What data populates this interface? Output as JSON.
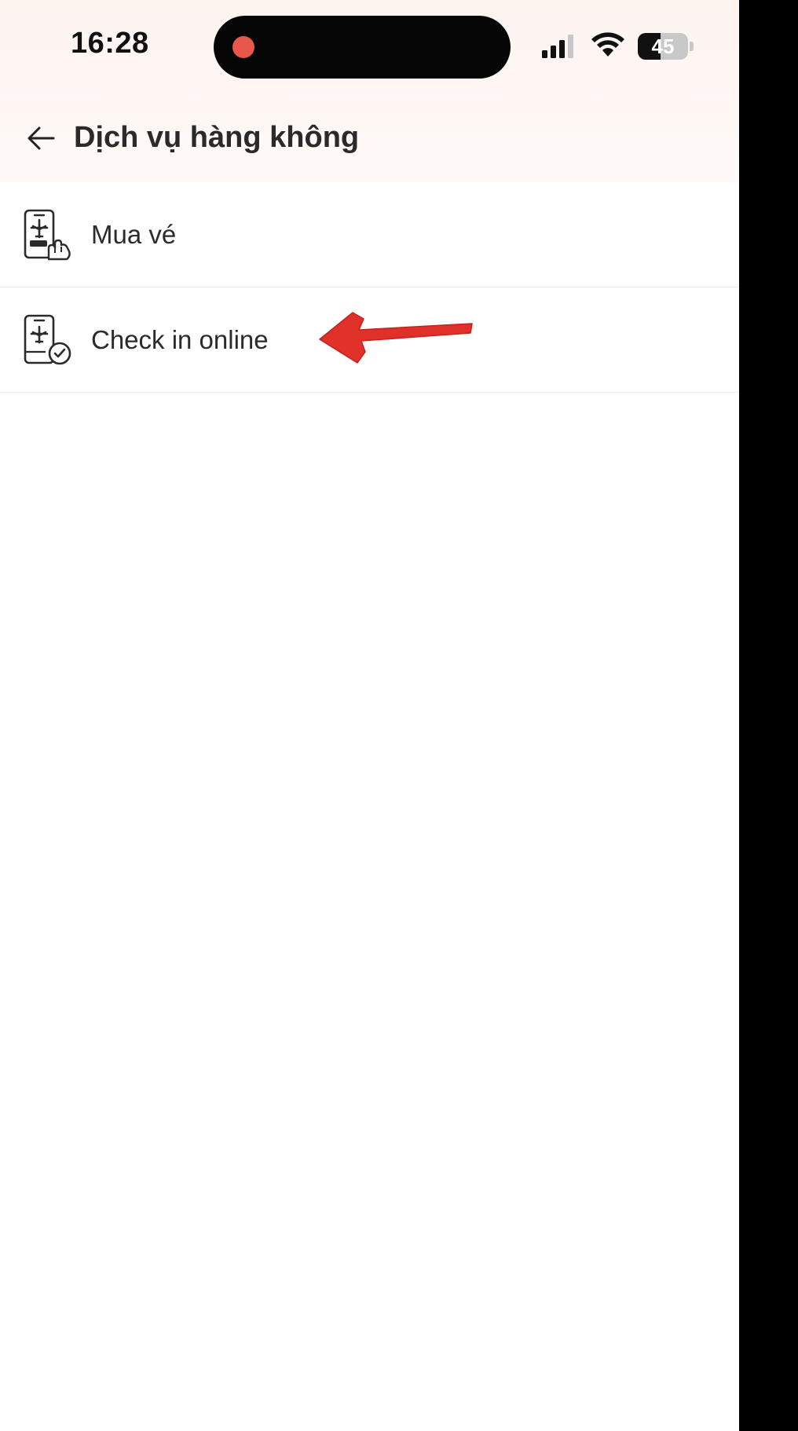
{
  "status_bar": {
    "time": "16:28",
    "battery_level": "45",
    "battery_fraction": 0.45,
    "record_indicator_color": "#e8584a"
  },
  "header": {
    "title": "Dịch vụ hàng không",
    "back_icon": "arrow-left-icon"
  },
  "menu": {
    "items": [
      {
        "label": "Mua vé",
        "icon": "phone-plane-ticket-hand-icon"
      },
      {
        "label": "Check in online",
        "icon": "phone-plane-check-icon"
      }
    ]
  },
  "annotation": {
    "arrow_color": "#e0302a",
    "points_to": "Check in online"
  },
  "colors": {
    "header_bg": "#fdf4f0",
    "text": "#2b2b2b",
    "divider": "#ececec"
  }
}
